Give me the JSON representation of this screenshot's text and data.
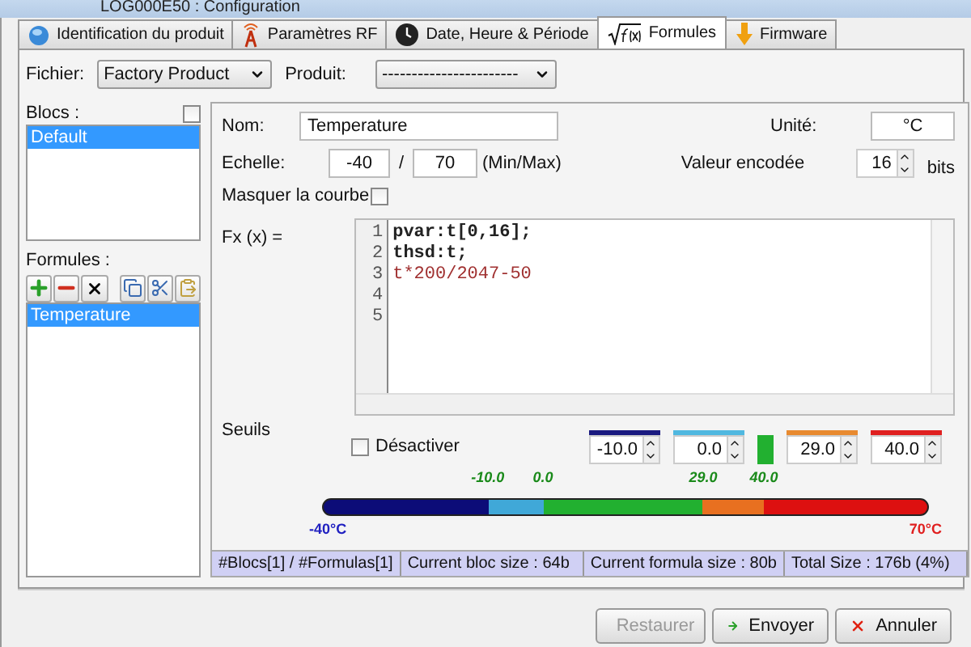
{
  "window": {
    "title": "LOG000E50 : Configuration"
  },
  "tabs": [
    {
      "label": "Identification du produit",
      "selected": false
    },
    {
      "label": "Paramètres RF",
      "selected": false
    },
    {
      "label": "Date, Heure & Période",
      "selected": false
    },
    {
      "label": "Formules",
      "selected": true
    },
    {
      "label": "Firmware",
      "selected": false
    }
  ],
  "file": {
    "label": "Fichier:",
    "value": "Factory Product"
  },
  "product": {
    "label": "Produit:",
    "value": "-----------------------"
  },
  "blocs": {
    "label": "Blocs :",
    "checked": false,
    "items": [
      {
        "label": "Default",
        "selected": true
      }
    ]
  },
  "formulas": {
    "label": "Formules :",
    "items": [
      {
        "label": "Temperature",
        "selected": true
      }
    ]
  },
  "name": {
    "label": "Nom:",
    "value": "Temperature"
  },
  "unit": {
    "label": "Unité:",
    "value": "°C"
  },
  "scale": {
    "label": "Echelle:",
    "min": "-40",
    "separator": "/",
    "max": "70",
    "hint": "(Min/Max)"
  },
  "encoded": {
    "label": "Valeur encodée",
    "value": "16",
    "unit": "bits"
  },
  "hide_curve": {
    "label": "Masquer la courbe",
    "checked": false
  },
  "formula": {
    "label": "Fx (x) =",
    "lines": [
      {
        "number": "1",
        "text": "pvar:t[0,16];",
        "kind": "declaration"
      },
      {
        "number": "2",
        "text": "thsd:t;",
        "kind": "declaration"
      },
      {
        "number": "3",
        "text": "t*200/2047-50",
        "kind": "expression"
      },
      {
        "number": "4"
      },
      {
        "number": "5"
      }
    ]
  },
  "thresholds": {
    "label": "Seuils",
    "disable": {
      "label": "Désactiver",
      "checked": false
    },
    "values": [
      {
        "value": "-10.0",
        "color": "#1a1a80"
      },
      {
        "value": "0.0",
        "color": "#50b8e0"
      },
      {
        "value": "29.0",
        "color": "#e88a30"
      },
      {
        "value": "40.0",
        "color": "#e02020"
      }
    ],
    "segments": [
      {
        "color": "#0c0c78"
      },
      {
        "color": "#40a8d8"
      },
      {
        "color": "#22b030"
      },
      {
        "color": "#e87020"
      },
      {
        "color": "#dd1010"
      }
    ],
    "markers": [
      "-10.0",
      "0.0",
      "29.0",
      "40.0"
    ],
    "min_label": "-40°C",
    "max_label": "70°C"
  },
  "status_bar": [
    "#Blocs[1] / #Formulas[1]",
    "Current bloc size : 64b",
    "Current formula size : 80b",
    "Total Size : 176b (4%)"
  ],
  "buttons": [
    {
      "label": "Restaurer",
      "kind": "reset",
      "disabled": true
    },
    {
      "label": "Envoyer",
      "kind": "send",
      "disabled": false
    },
    {
      "label": "Annuler",
      "kind": "cancel",
      "disabled": false
    }
  ]
}
